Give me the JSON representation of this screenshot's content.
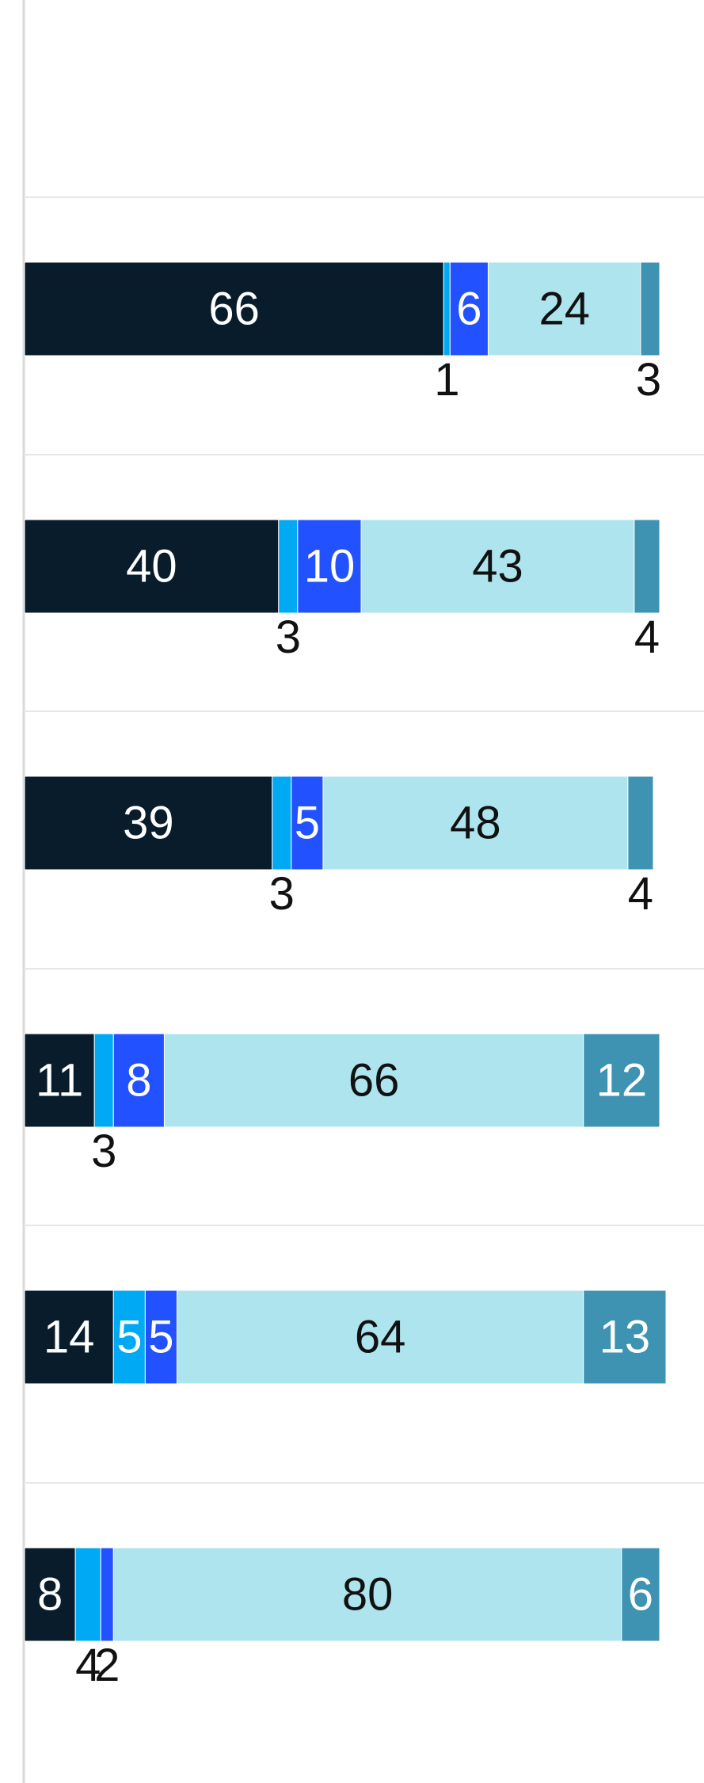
{
  "chart_data": {
    "type": "bar",
    "orientation": "horizontal",
    "stacked": true,
    "grid": true,
    "xlim": [
      0,
      100
    ],
    "rows": [
      {
        "segments": [
          66,
          1,
          6,
          24,
          3
        ]
      },
      {
        "segments": [
          40,
          3,
          10,
          43,
          4
        ]
      },
      {
        "segments": [
          39,
          3,
          5,
          48,
          4
        ]
      },
      {
        "segments": [
          11,
          3,
          8,
          66,
          12
        ]
      },
      {
        "segments": [
          14,
          5,
          5,
          64,
          13
        ]
      },
      {
        "segments": [
          8,
          4,
          2,
          80,
          6
        ]
      }
    ],
    "inside_labels": [
      [
        true,
        false,
        true,
        true,
        false
      ],
      [
        true,
        false,
        true,
        true,
        false
      ],
      [
        true,
        false,
        true,
        true,
        false
      ],
      [
        true,
        false,
        true,
        true,
        true
      ],
      [
        true,
        true,
        true,
        true,
        true
      ],
      [
        true,
        false,
        false,
        true,
        true
      ]
    ],
    "outside_labels": [
      [
        false,
        true,
        false,
        false,
        true
      ],
      [
        false,
        true,
        false,
        false,
        true
      ],
      [
        false,
        true,
        false,
        false,
        true
      ],
      [
        false,
        true,
        false,
        false,
        false
      ],
      [
        false,
        false,
        false,
        false,
        false
      ],
      [
        false,
        true,
        true,
        false,
        false
      ]
    ],
    "colors": [
      "#081c2b",
      "#00a9f4",
      "#2251ff",
      "#ade4ee",
      "#3e92b2"
    ],
    "text_colors": [
      "#ffffff",
      "#ffffff",
      "#ffffff",
      "#111111",
      "#ffffff"
    ]
  }
}
